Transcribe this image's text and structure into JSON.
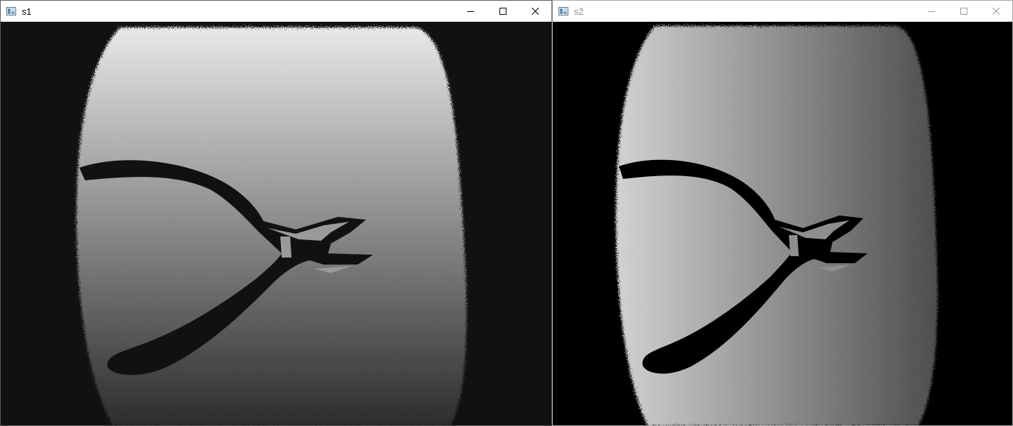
{
  "windows": [
    {
      "title": "s1",
      "active": true,
      "controls": {
        "minimize": "minimize-icon",
        "maximize": "maximize-icon",
        "close": "close-icon"
      },
      "image": {
        "description_icon": "grayscale-image",
        "background": "#111111",
        "gradient_direction": "vertical",
        "gradient_colors": [
          "#e8e8e8",
          "#2c2c2c"
        ],
        "object_color": "#111111"
      }
    },
    {
      "title": "s2",
      "active": false,
      "controls": {
        "minimize": "minimize-icon",
        "maximize": "maximize-icon",
        "close": "close-icon"
      },
      "image": {
        "description_icon": "grayscale-image",
        "background": "#000000",
        "gradient_direction": "horizontal",
        "gradient_colors": [
          "#d2d2d2",
          "#4e4e4e"
        ],
        "object_color": "#000000"
      }
    }
  ],
  "colors": {
    "titlebar": "#ffffff",
    "active_border": "#5d5d5d",
    "inactive_border": "#aaaaaa",
    "active_title": "#000000",
    "inactive_title": "#8a8a8a"
  }
}
